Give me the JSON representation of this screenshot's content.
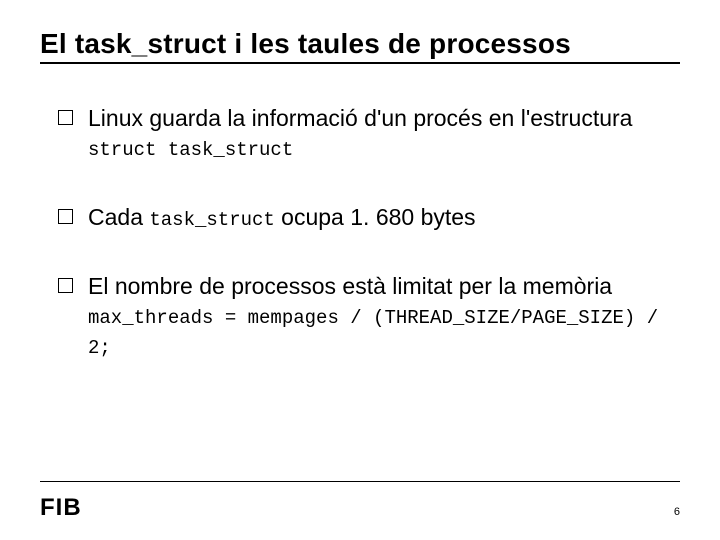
{
  "title": "El task_struct i les taules de processos",
  "bullets": [
    {
      "pre": "Linux guarda la informació d'un procés en l'estructura ",
      "code": "struct task_struct",
      "post": ""
    },
    {
      "pre": "Cada ",
      "code": "task_struct",
      "post": " ocupa 1. 680 bytes"
    },
    {
      "pre": "El nombre de processos està limitat per la memòria ",
      "code": "max_threads = mempages / (THREAD_SIZE/PAGE_SIZE) / 2;",
      "post": ""
    }
  ],
  "logo_text": "FIB",
  "page_number": "6"
}
